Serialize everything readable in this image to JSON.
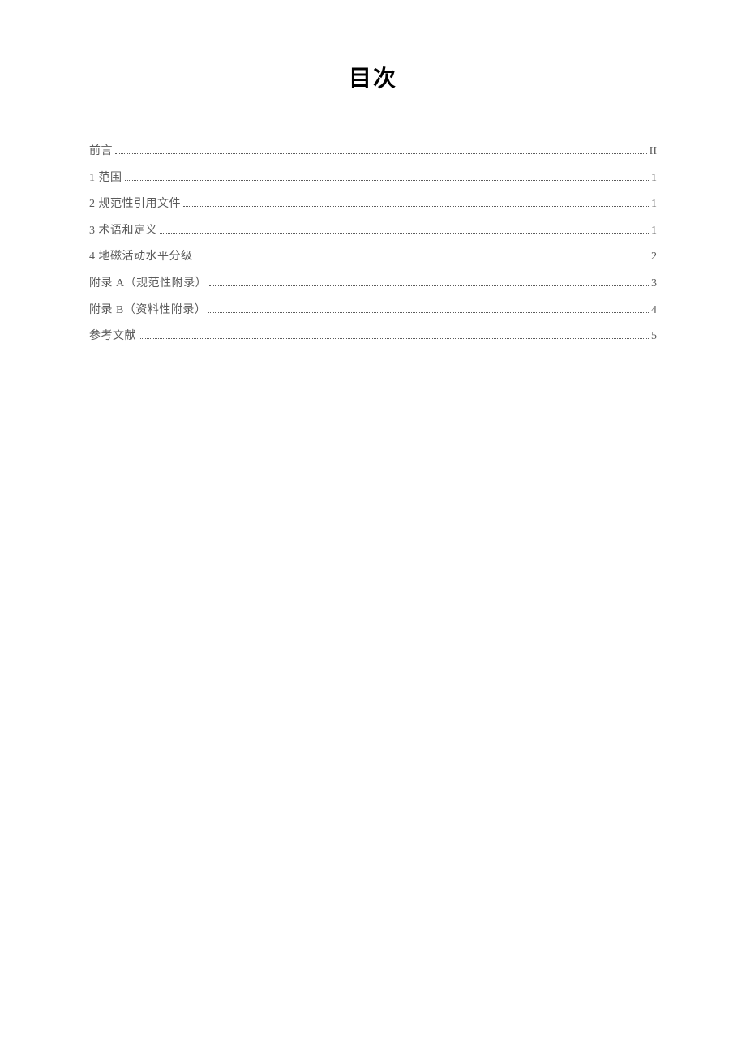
{
  "title": "目次",
  "toc": [
    {
      "label": "前言",
      "page": "II"
    },
    {
      "label": "1 范围",
      "page": "1"
    },
    {
      "label": "2 规范性引用文件",
      "page": "1"
    },
    {
      "label": "3 术语和定义",
      "page": "1"
    },
    {
      "label": "4 地磁活动水平分级",
      "page": "2"
    },
    {
      "label": "附录 A（规范性附录）",
      "page": "3"
    },
    {
      "label": "附录 B（资料性附录）",
      "page": "4"
    },
    {
      "label": "参考文献",
      "page": "5"
    }
  ]
}
